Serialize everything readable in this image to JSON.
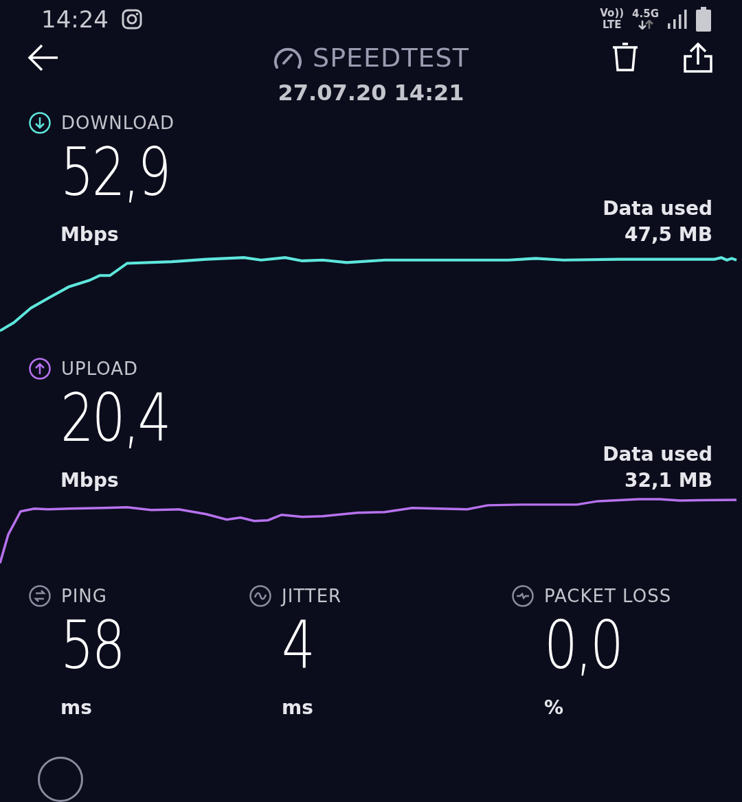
{
  "status_bar": {
    "time": "14:24",
    "volte": "Vo))",
    "lte": "LTE",
    "network": "4.5G"
  },
  "header": {
    "title": "SPEEDTEST",
    "date": "27.07.20 14:21"
  },
  "results": [
    {
      "kind": "download",
      "label": "DOWNLOAD",
      "value": "52,9",
      "unit": "Mbps",
      "data_label": "Data used",
      "data_value": "47,5 MB",
      "color": "#5ee6dc"
    },
    {
      "kind": "upload",
      "label": "UPLOAD",
      "value": "20,4",
      "unit": "Mbps",
      "data_label": "Data used",
      "data_value": "32,1 MB",
      "color": "#b872ee"
    }
  ],
  "metrics": [
    {
      "kind": "ping",
      "label": "PING",
      "value": "58",
      "unit": "ms"
    },
    {
      "kind": "jitter",
      "label": "JITTER",
      "value": "4",
      "unit": "ms"
    },
    {
      "kind": "packet_loss",
      "label": "PACKET LOSS",
      "value": "0,0",
      "unit": "%"
    }
  ]
}
